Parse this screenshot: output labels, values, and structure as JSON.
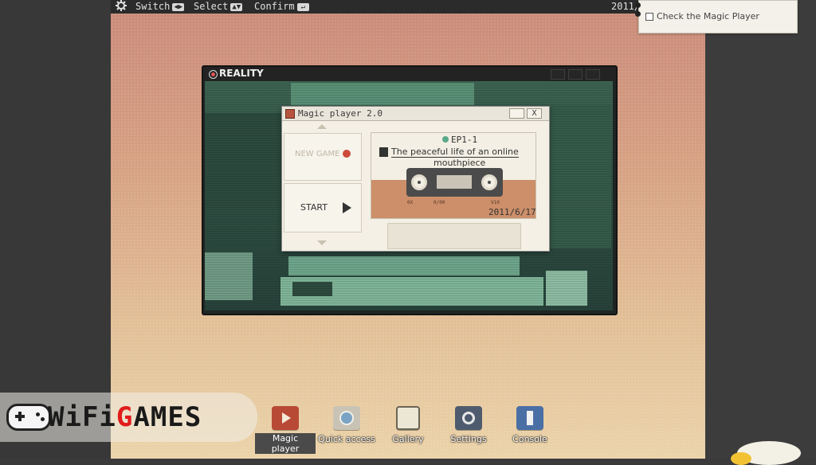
{
  "topbar": {
    "switch_label": "Switch",
    "select_label": "Select",
    "confirm_label": "Confirm",
    "switch_keys": "◀▶",
    "select_keys": "▲▼",
    "confirm_key": "↵",
    "date": "2011/"
  },
  "task_note": {
    "text": "Check the Magic Player",
    "checked": false
  },
  "reality_window": {
    "title": "REALITY"
  },
  "magic_player": {
    "title": "Magic player 2.0",
    "close_label": "X",
    "menu": {
      "new_game": "NEW GAME",
      "start": "START"
    },
    "cassette": {
      "episode": "EP1-1",
      "title_line1": "The peaceful life of an online",
      "title_line2": "mouthpiece",
      "date": "2011/6/17",
      "marks": [
        "0X",
        "0/00",
        "V10"
      ]
    }
  },
  "dock": {
    "items": [
      {
        "label": "Magic player",
        "icon": "play-video-icon",
        "active": true
      },
      {
        "label": "Quick access",
        "icon": "folder-disc-icon",
        "active": false
      },
      {
        "label": "Gallery",
        "icon": "book-icon",
        "active": false
      },
      {
        "label": "Settings",
        "icon": "gear-wrench-icon",
        "active": false
      },
      {
        "label": "Console",
        "icon": "exit-person-icon",
        "active": false
      }
    ]
  },
  "watermark": {
    "text_wifi": "WiFi",
    "text_g": "G",
    "text_ames": "AMES"
  },
  "colors": {
    "accent_red": "#cc4b3a",
    "status_green": "#5ba88a",
    "cassette_band": "#cc8f6a"
  }
}
